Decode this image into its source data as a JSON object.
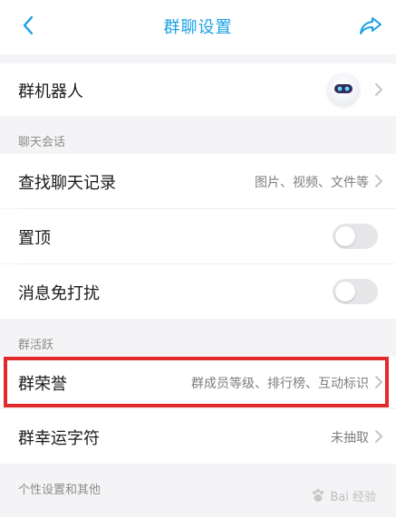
{
  "nav": {
    "title": "群聊设置",
    "back_icon": "chevron-left-icon",
    "share_icon": "share-arrow-icon"
  },
  "rows": {
    "robot": {
      "label": "群机器人"
    },
    "search_history": {
      "label": "查找聊天记录",
      "value": "图片、视频、文件等"
    },
    "pin": {
      "label": "置顶",
      "enabled": false
    },
    "mute": {
      "label": "消息免打扰",
      "enabled": false
    },
    "honor": {
      "label": "群荣誉",
      "value": "群成员等级、排行榜、互动标识"
    },
    "lucky_char": {
      "label": "群幸运字符",
      "value": "未抽取"
    }
  },
  "sections": {
    "chat": "聊天会话",
    "activity": "群活跃",
    "personal": "个性设置和其他"
  },
  "watermark": {
    "text": "Bai 经验"
  },
  "colors": {
    "accent": "#1aa1e6",
    "highlight_border": "#e22a2a",
    "toggle_off": "#e6e6e8"
  }
}
